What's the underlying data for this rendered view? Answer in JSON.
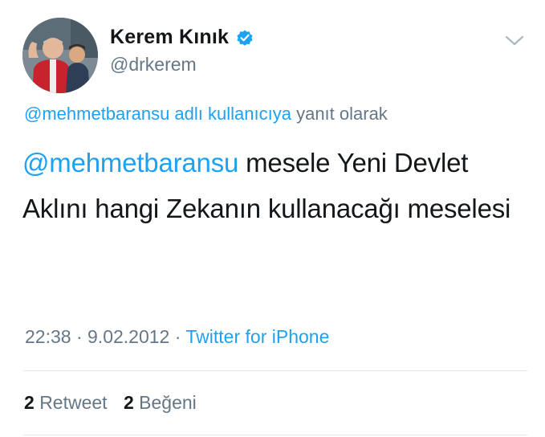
{
  "user": {
    "display_name": "Kerem Kınık",
    "handle": "@drkerem",
    "verified": true
  },
  "reply_context": {
    "mention": "@mehmetbaransu adlı kullanıcıya",
    "suffix": "yanıt olarak"
  },
  "tweet": {
    "mention": "@mehmetbaransu",
    "text": "mesele Yeni Devlet Aklını hangi Zekanın kullanacağı meselesi"
  },
  "meta": {
    "time": "22:38",
    "separator": "·",
    "date": "9.02.2012",
    "source": "Twitter for iPhone"
  },
  "stats": {
    "retweets_count": "2",
    "retweets_label": "Retweet",
    "likes_count": "2",
    "likes_label": "Beğeni"
  },
  "icons": {
    "verified": "verified-badge-icon",
    "menu": "chevron-down-icon"
  },
  "colors": {
    "link": "#1da1f2",
    "text": "#14171a",
    "secondary": "#657786"
  }
}
